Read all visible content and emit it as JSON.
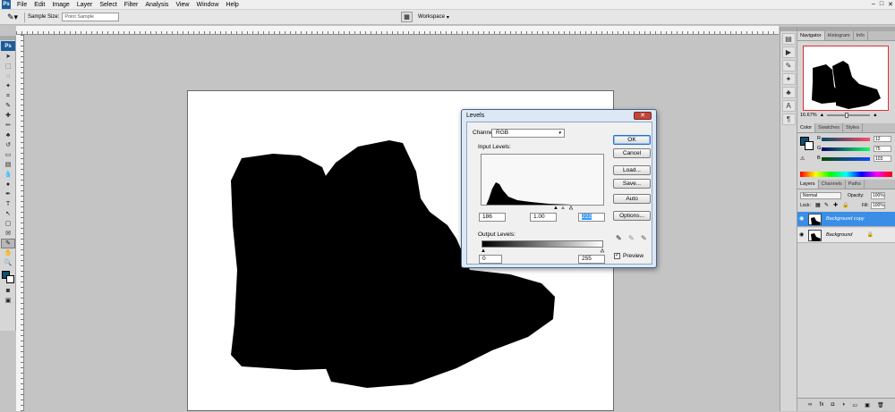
{
  "menu": {
    "logo": "Ps",
    "items": [
      "File",
      "Edit",
      "Image",
      "Layer",
      "Select",
      "Filter",
      "Analysis",
      "View",
      "Window",
      "Help"
    ]
  },
  "options": {
    "sample_size_label": "Sample Size:",
    "sample_size_value": "Point Sample",
    "workspace_label": "Workspace"
  },
  "toolbox": {
    "logo": "Ps"
  },
  "levels_dialog": {
    "title": "Levels",
    "channel_label": "Channel:",
    "channel_value": "RGB",
    "input_levels_label": "Input Levels:",
    "input_black": "186",
    "input_gamma": "1.00",
    "input_white": "222",
    "output_levels_label": "Output Levels:",
    "output_black": "0",
    "output_white": "255",
    "buttons": {
      "ok": "OK",
      "cancel": "Cancel",
      "load": "Load...",
      "save": "Save...",
      "auto": "Auto",
      "options": "Options..."
    },
    "preview_label": "Preview",
    "preview_checked": true
  },
  "navigator_panel": {
    "tabs": [
      "Navigator",
      "Histogram",
      "Info"
    ],
    "zoom_value": "16.67%"
  },
  "color_panel": {
    "tabs": [
      "Color",
      "Swatches",
      "Styles"
    ],
    "r_label": "R",
    "g_label": "G",
    "b_label": "B",
    "r_value": "12",
    "g_value": "75",
    "b_value": "103",
    "fg_color": "#0c4f6e"
  },
  "layers_panel": {
    "tabs": [
      "Layers",
      "Channels",
      "Paths"
    ],
    "blend_mode": "Normal",
    "opacity_label": "Opacity:",
    "opacity_value": "100%",
    "lock_label": "Lock:",
    "fill_label": "Fill:",
    "fill_value": "100%",
    "layers": [
      {
        "name": "Background copy",
        "selected": true
      },
      {
        "name": "Background",
        "selected": false,
        "locked": true
      }
    ]
  }
}
